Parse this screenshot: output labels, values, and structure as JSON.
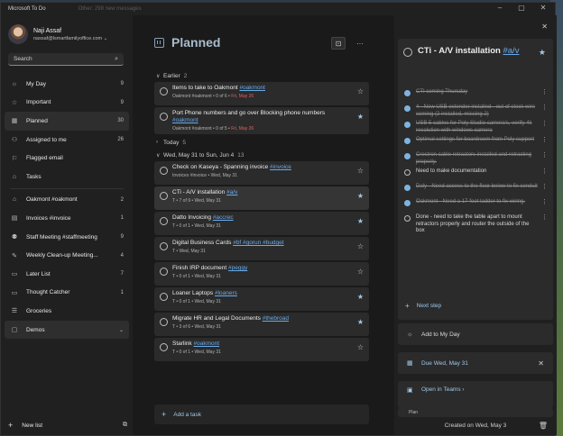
{
  "app": {
    "title": "Microsoft To Do",
    "ghost_text": "Other: 298 new messages"
  },
  "profile": {
    "name": "Naji Assaf",
    "email": "nassaf@lsmartfamilyoffice.com"
  },
  "search": {
    "placeholder": "Search"
  },
  "nav": [
    {
      "label": "My Day",
      "count": "9",
      "icon": "sun-icon",
      "glyph": "☼"
    },
    {
      "label": "Important",
      "count": "9",
      "icon": "star-icon",
      "glyph": "☆"
    },
    {
      "label": "Planned",
      "count": "30",
      "icon": "calendar-icon",
      "glyph": "▦",
      "active": true
    },
    {
      "label": "Assigned to me",
      "count": "26",
      "icon": "person-icon",
      "glyph": "⚇"
    },
    {
      "label": "Flagged email",
      "count": "",
      "icon": "flag-icon",
      "glyph": "⚐"
    },
    {
      "label": "Tasks",
      "count": "",
      "icon": "home-icon",
      "glyph": "⌂"
    }
  ],
  "lists": [
    {
      "label": "Oakmont #oakmont",
      "count": "2",
      "icon": "house-icon",
      "glyph": "⌂"
    },
    {
      "label": "Invoices #invoice",
      "count": "1",
      "icon": "card-icon",
      "glyph": "▤"
    },
    {
      "label": "Staff Meeting #staffmeeting",
      "count": "9",
      "icon": "people-icon",
      "glyph": "⚉"
    },
    {
      "label": "Weekly Clean-up Meeting...",
      "count": "4",
      "icon": "broom-icon",
      "glyph": "✎"
    },
    {
      "label": "Later List",
      "count": "7",
      "icon": "list-icon",
      "glyph": "▭"
    },
    {
      "label": "Thought Catcher",
      "count": "1",
      "icon": "note-icon",
      "glyph": "▭"
    },
    {
      "label": "Groceries",
      "count": "",
      "icon": "list-icon",
      "glyph": "☰"
    },
    {
      "label": "Demos",
      "count": "",
      "icon": "group-icon",
      "glyph": "▢",
      "active": true
    }
  ],
  "new_list_label": "New list",
  "main": {
    "title": "Planned",
    "groups": [
      {
        "label": "Earlier",
        "count": "2",
        "chevron": "∨",
        "tasks": [
          {
            "title": "Items to take to Oakmont",
            "tag": "#oakmont",
            "meta": "Oakmont #oakmont  •  0 of 6  •  ",
            "due": "Fri, May 26",
            "due_red": true,
            "starred": false
          },
          {
            "title": "Port Phone numbers and go over Blocking phone numbers",
            "tag": "#oakmont",
            "meta": "Oakmont #oakmont  •  0 of 5  •  ",
            "due": "Fri, May 26",
            "due_red": true,
            "starred": true
          }
        ]
      },
      {
        "label": "Today",
        "count": "5",
        "chevron": "›",
        "tasks": []
      },
      {
        "label": "Wed, May 31 to Sun, Jun 4",
        "count": "13",
        "chevron": "∨",
        "tasks": [
          {
            "title": "Check on Kaseya - Spanning invoice",
            "tag": "#invoice",
            "meta": "Invoices #invoice  •  Wed, May 31",
            "due": "",
            "starred": false
          },
          {
            "title": "CTi - A/V installation",
            "tag": "#a/v",
            "meta": "T  •  7 of 9  •  Wed, May 31",
            "due": "",
            "starred": true,
            "selected": true
          },
          {
            "title": "Datto Invoicing",
            "tag": "#accrec",
            "meta": "T  •  0 of 1  •  Wed, May 31",
            "due": "",
            "starred": true
          },
          {
            "title": "Digital Business Cards",
            "tag": "#bf #gorun #budget",
            "meta": "T  •  Wed, May 31",
            "due": "",
            "starred": false
          },
          {
            "title": "Finish IRP document",
            "tag": "#peggy",
            "meta": "T  •  0 of 1  •  Wed, May 31",
            "due": "",
            "starred": false
          },
          {
            "title": "Loaner Laptops",
            "tag": "#loaners",
            "meta": "T  •  0 of 1  •  Wed, May 31",
            "due": "",
            "starred": true
          },
          {
            "title": "Migrate HR and Legal Documents",
            "tag": "#thebroad",
            "meta": "T  •  3 of 6  •  Wed, May 31",
            "due": "",
            "starred": true
          },
          {
            "title": "Starlink",
            "tag": "#oakmont",
            "meta": "T  •  0 of 1  •  Wed, May 31",
            "due": "",
            "starred": false
          }
        ]
      }
    ],
    "add_task_label": "Add a task"
  },
  "detail": {
    "title": "CTi - A/V installation",
    "title_tag": "#a/v",
    "steps": [
      {
        "text": "CTI coming Thursday",
        "done": true
      },
      {
        "text": "4 - New USB extender installed - out of stock wire coming (2 installed, missing 2)",
        "done": true
      },
      {
        "text": "USB 5 cables for Poly Studio camera's, verify 4k resolution with windows camera",
        "done": true
      },
      {
        "text": "Optimal settings for boardroom from Poly support",
        "done": true
      },
      {
        "text": "Crestron cable retractors installed and retracting properly.",
        "done": true
      },
      {
        "text": "Need to make documentation",
        "done": false
      },
      {
        "text": "Daly - Need access to the floor below to fix conduit",
        "done": true
      },
      {
        "text": "Oakmont - Need a 17-foot ladder to fix wiring.",
        "done": true
      },
      {
        "text": "Done - need to take the table apart to mount retractors properly and router the outside of the box",
        "done": false
      }
    ],
    "next_step_label": "Next step",
    "add_my_day_label": "Add to My Day",
    "due_label": "Due Wed, May 31",
    "open_teams_label": "Open in Teams",
    "attachment_label": "Plan",
    "created_label": "Created on Wed, May 3"
  }
}
